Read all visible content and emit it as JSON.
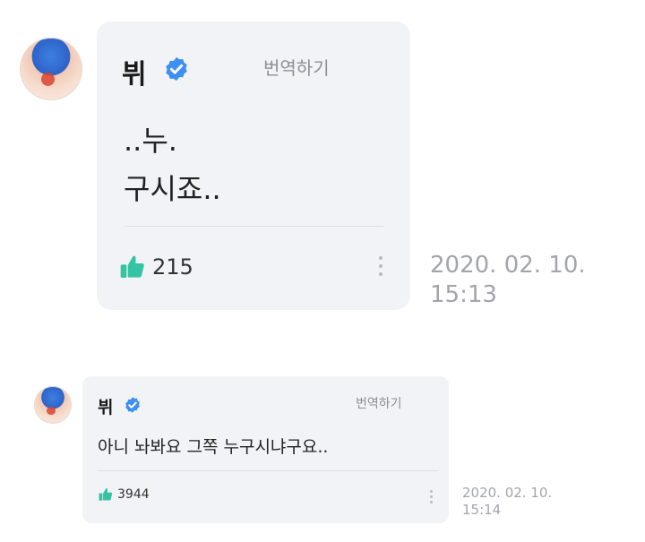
{
  "comments": [
    {
      "author": "뷔",
      "verified_icon": "verified-badge-icon",
      "translate_label": "번역하기",
      "lines": [
        "..누.",
        "구시죠.."
      ],
      "likes": "215",
      "like_icon": "thumbs-up-icon",
      "menu_icon": "more-vertical-icon",
      "timestamp": {
        "date": "2020. 02. 10.",
        "time": "15:13"
      }
    },
    {
      "author": "뷔",
      "verified_icon": "verified-badge-icon",
      "translate_label": "번역하기",
      "lines": [
        "아니 놔봐요 그쪽 누구시냐구요.."
      ],
      "likes": "3944",
      "like_icon": "thumbs-up-icon",
      "menu_icon": "more-vertical-icon",
      "timestamp": {
        "date": "2020. 02. 10.",
        "time": "15:14"
      }
    }
  ],
  "colors": {
    "card_bg": "#f2f3f7",
    "verified_blue": "#3d8ff2",
    "like_green": "#35c4a3",
    "muted_text": "#8d8f96",
    "timestamp_text": "#a3a5aa"
  }
}
